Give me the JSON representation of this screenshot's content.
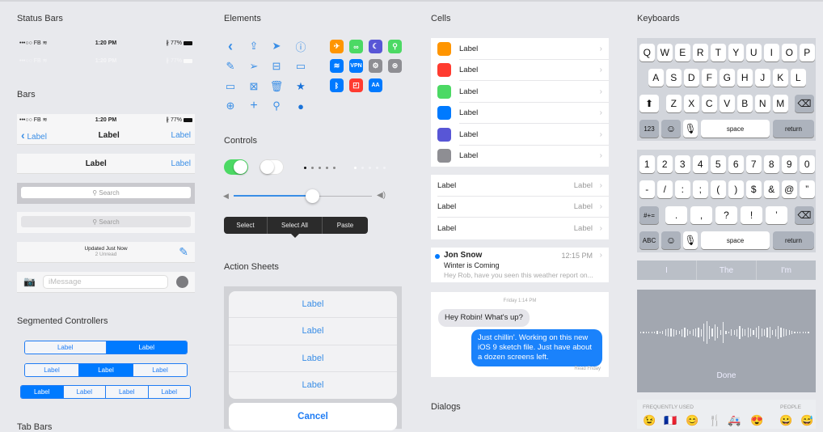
{
  "sections": {
    "status_bars": "Status Bars",
    "bars": "Bars",
    "segmented": "Segmented Controllers",
    "tab_bars": "Tab Bars",
    "elements": "Elements",
    "controls": "Controls",
    "action_sheets": "Action Sheets",
    "cells": "Cells",
    "dialogs": "Dialogs",
    "keyboards": "Keyboards"
  },
  "status": {
    "carrier": "•••○○ FB",
    "time": "1:20 PM",
    "battery": "77%"
  },
  "nav": {
    "back": "Label",
    "title": "Label",
    "right": "Label"
  },
  "nav2": {
    "title": "Label",
    "right": "Label"
  },
  "search": {
    "placeholder": "Search"
  },
  "toolbar": {
    "title": "Updated Just Now",
    "subtitle": "2 Unread"
  },
  "imessage": {
    "placeholder": "iMessage"
  },
  "segmented": [
    [
      "Label",
      "Label"
    ],
    [
      "Label",
      "Label",
      "Label"
    ],
    [
      "Label",
      "Label",
      "Label",
      "Label"
    ]
  ],
  "controls": {
    "slider_value": 0.57,
    "page_index": 0,
    "page_count": 5
  },
  "edit_menu": [
    "Select",
    "Select All",
    "Paste"
  ],
  "action_sheet": {
    "items": [
      "Label",
      "Label",
      "Label",
      "Label"
    ],
    "cancel": "Cancel"
  },
  "cells": {
    "icon_cells": [
      {
        "label": "Label",
        "color": "#ff9500"
      },
      {
        "label": "Label",
        "color": "#ff3b30"
      },
      {
        "label": "Label",
        "color": "#4cd964"
      },
      {
        "label": "Label",
        "color": "#007aff"
      },
      {
        "label": "Label",
        "color": "#5856d6"
      },
      {
        "label": "Label",
        "color": "#8e8e93"
      }
    ],
    "detail_cells": [
      {
        "label": "Label",
        "detail": "Label"
      },
      {
        "label": "Label",
        "detail": "Label"
      },
      {
        "label": "Label",
        "detail": "Label"
      }
    ],
    "mail": {
      "sender": "Jon Snow",
      "time": "12:15 PM",
      "subject": "Winter is Coming",
      "preview": "Hey Rob, have you seen this weather report on..."
    }
  },
  "messages": {
    "timestamp": "Friday 1:14 PM",
    "incoming": "Hey Robin! What's up?",
    "outgoing": "Just chillin'. Working on this new iOS 9 sketch file. Just have about a dozen screens left.",
    "read": "Read Friday"
  },
  "keyboard": {
    "row1": [
      "Q",
      "W",
      "E",
      "R",
      "T",
      "Y",
      "U",
      "I",
      "O",
      "P"
    ],
    "row2": [
      "A",
      "S",
      "D",
      "F",
      "G",
      "H",
      "J",
      "K",
      "L"
    ],
    "row3": [
      "Z",
      "X",
      "C",
      "V",
      "B",
      "N",
      "M"
    ],
    "num": "123",
    "space": "space",
    "return": "return",
    "nrow1": [
      "1",
      "2",
      "3",
      "4",
      "5",
      "6",
      "7",
      "8",
      "9",
      "0"
    ],
    "nrow2": [
      "-",
      "/",
      ":",
      ";",
      "(",
      ")",
      "$",
      "&",
      "@",
      "”"
    ],
    "nrow3": [
      ".",
      ",",
      "?",
      "!",
      "’"
    ],
    "sym": "#+=",
    "abc": "ABC"
  },
  "suggestions": [
    "I",
    "The",
    "I'm"
  ],
  "dictation": {
    "done": "Done"
  },
  "emoji": {
    "frequent": "FREQUENTLY USED",
    "people": "PEOPLE",
    "items": [
      "😉",
      "🇫🇷",
      "😊",
      "🍴",
      "🚑",
      "😍",
      "😀",
      "😅"
    ]
  }
}
